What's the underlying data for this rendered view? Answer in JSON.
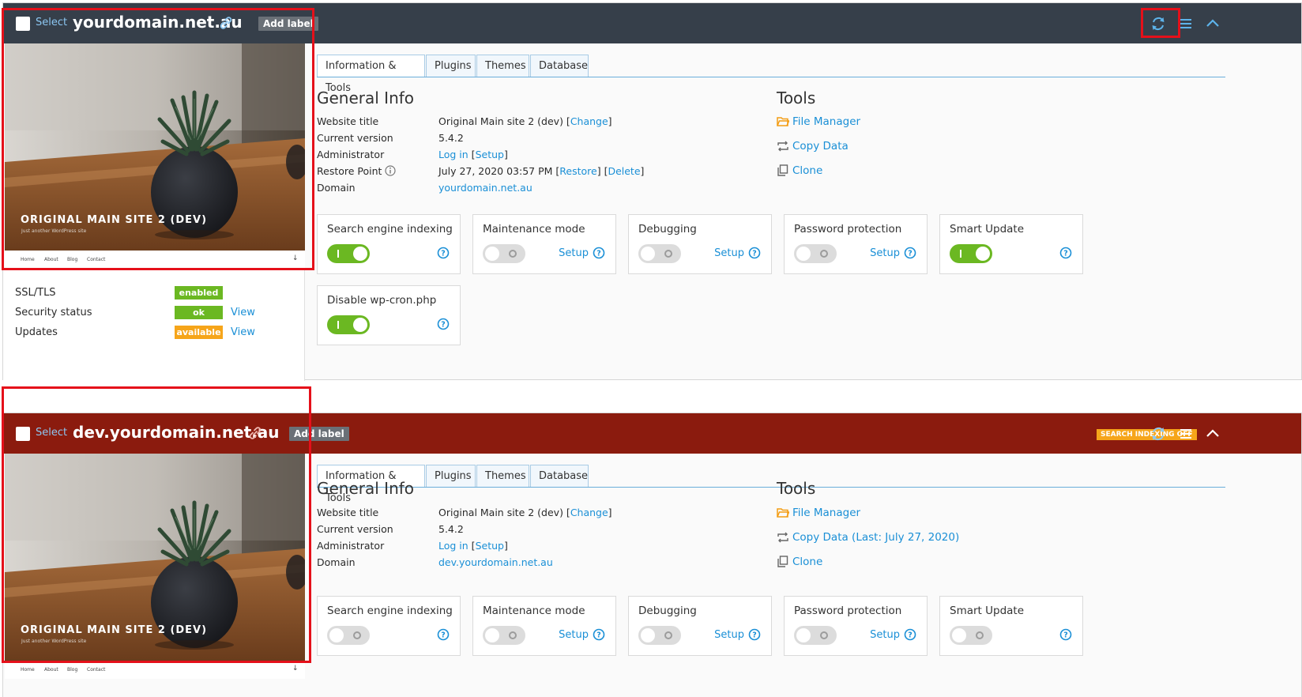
{
  "common": {
    "select_label": "Select",
    "add_label": "Add label",
    "tabs": [
      "Information & Tools",
      "Plugins",
      "Themes",
      "Database"
    ],
    "general_info_heading": "General Info",
    "tools_heading": "Tools",
    "labels": {
      "website_title": "Website title",
      "current_version": "Current version",
      "administrator": "Administrator",
      "restore_point": "Restore Point",
      "domain": "Domain"
    },
    "change_link": "Change",
    "login_link": "Log in",
    "setup_link": "Setup",
    "restore_link": "Restore",
    "delete_link": "Delete",
    "tools": {
      "file_manager": "File Manager",
      "clone": "Clone"
    },
    "setup_label": "Setup",
    "preview": {
      "title": "ORIGINAL MAIN SITE 2 (DEV)",
      "subtitle": "Just another WordPress site",
      "nav": [
        "Home",
        "About",
        "Blog",
        "Contact"
      ]
    },
    "colors": {
      "accent": "#1a8fd6",
      "toggle_on": "#6bb822",
      "header_dark": "#363f4a",
      "header_red": "#8b1b0e",
      "highlight": "#e5101a"
    }
  },
  "site1": {
    "domain": "yourdomain.net.au",
    "info": {
      "website_title": "Original Main site 2 (dev)",
      "current_version": "5.4.2",
      "restore_point": "July 27, 2020 03:57 PM",
      "domain": "yourdomain.net.au"
    },
    "copy_data": "Copy Data",
    "status": [
      {
        "label": "SSL/TLS",
        "badge": "enabled",
        "color": "#6bb822",
        "view": ""
      },
      {
        "label": "Security status",
        "badge": "ok",
        "color": "#6bb822",
        "view": "View"
      },
      {
        "label": "Updates",
        "badge": "available",
        "color": "#f6a51a",
        "view": "View"
      }
    ],
    "cards": [
      {
        "title": "Search engine indexing",
        "on": true,
        "setup": false
      },
      {
        "title": "Maintenance mode",
        "on": false,
        "setup": true
      },
      {
        "title": "Debugging",
        "on": false,
        "setup": true
      },
      {
        "title": "Password protection",
        "on": false,
        "setup": true
      },
      {
        "title": "Smart Update",
        "on": true,
        "setup": false
      },
      {
        "title": "Disable wp-cron.php",
        "on": true,
        "setup": false
      }
    ]
  },
  "site2": {
    "domain": "dev.yourdomain.net.au",
    "warning_badge": "SEARCH INDEXING OFF",
    "info": {
      "website_title": "Original Main site 2 (dev)",
      "current_version": "5.4.2",
      "domain": "dev.yourdomain.net.au"
    },
    "copy_data": "Copy Data (Last: July 27, 2020)",
    "cards": [
      {
        "title": "Search engine indexing",
        "on": false,
        "setup": false
      },
      {
        "title": "Maintenance mode",
        "on": false,
        "setup": true
      },
      {
        "title": "Debugging",
        "on": false,
        "setup": true
      },
      {
        "title": "Password protection",
        "on": false,
        "setup": true
      },
      {
        "title": "Smart Update",
        "on": false,
        "setup": false
      }
    ]
  }
}
